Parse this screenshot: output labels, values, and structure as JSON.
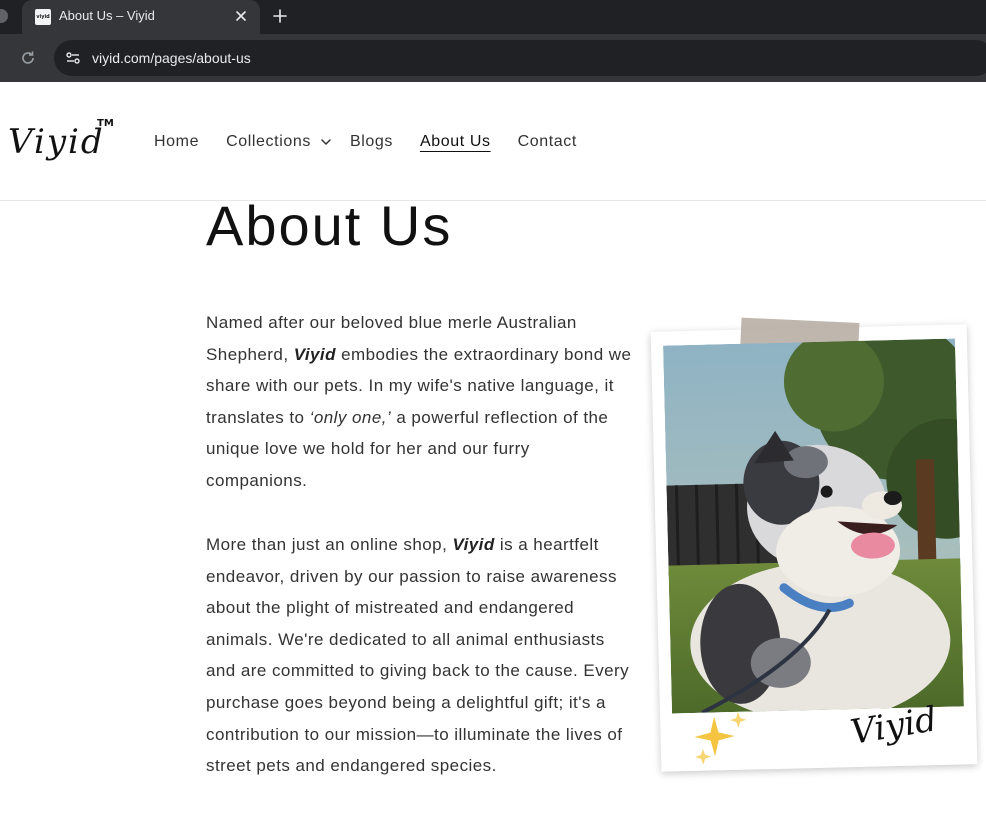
{
  "browser": {
    "tab_favicon_text": "viyid",
    "tab_title": "About Us – Viyid",
    "url": "viyid.com/pages/about-us"
  },
  "site": {
    "logo": "Viyid",
    "logo_tm": "TM",
    "nav": {
      "home": "Home",
      "collections": "Collections",
      "blogs": "Blogs",
      "about": "About Us",
      "contact": "Contact"
    },
    "active_nav": "About Us"
  },
  "content": {
    "title": "About Us",
    "p1": {
      "a": "Named after our beloved blue merle Australian Shepherd, ",
      "brand": "Viyid",
      "b": " embodies the extraordinary bond we share with our pets. In my wife's native language, it translates to ",
      "quote": "‘only one,’",
      "c": " a powerful reflection of the unique love we hold for her and our furry companions."
    },
    "p2": {
      "a": "More than just an online shop, ",
      "brand": "Viyid",
      "b": " is a heartfelt endeavor, driven by our passion to raise awareness about the plight of mistreated and endangered animals. We're dedicated to all animal enthusiasts and are committed to giving back to the cause. Every purchase goes beyond being a delightful gift; it's a contribution to our mission—to illuminate the lives of street pets and endangered species."
    },
    "photo": {
      "signature": "Viyid"
    }
  },
  "colors": {
    "chrome_dark": "#202124",
    "chrome_tab": "#35363a",
    "text": "#333333",
    "heading": "#111111",
    "sparkle": "#f5c542",
    "collar": "#4a7fc1"
  },
  "icons": [
    "favicon",
    "close-icon",
    "plus-icon",
    "reload-icon",
    "site-info-icon",
    "chevron-down-icon",
    "sparkle-icon"
  ]
}
